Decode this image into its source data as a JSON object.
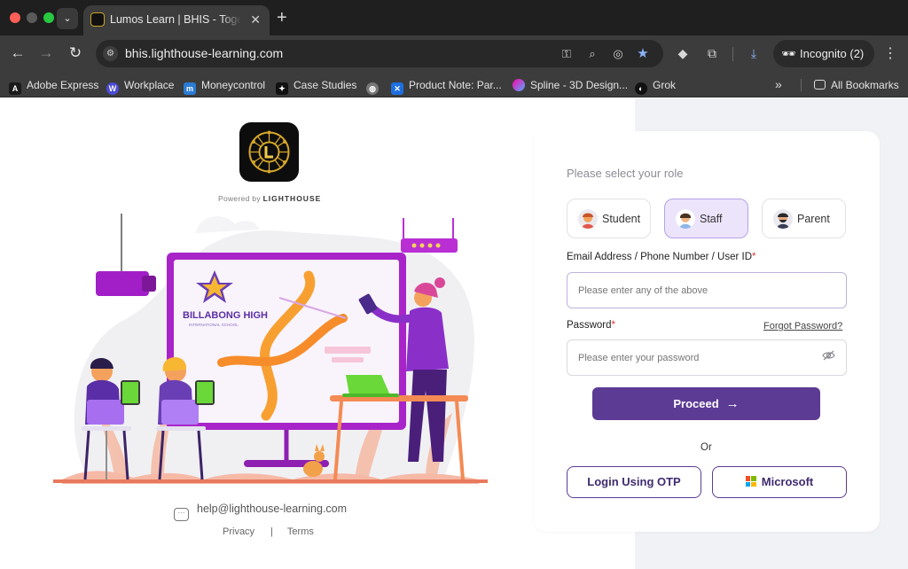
{
  "browser": {
    "tab_title": "Lumos Learn | BHIS - Together",
    "url": "bhis.lighthouse-learning.com",
    "incognito_label": "Incognito (2)",
    "bookmarks": [
      {
        "label": "Adobe Express",
        "color": "#1a1a1a"
      },
      {
        "label": "Workplace",
        "color": "#4b4bd6"
      },
      {
        "label": "Moneycontrol",
        "color": "#2a7bd4"
      },
      {
        "label": "Case Studies",
        "color": "#111111"
      },
      {
        "label": "",
        "color": "#777777"
      },
      {
        "label": "Product Note: Par...",
        "color": "#1d6fe0"
      },
      {
        "label": "Spline - 3D Design...",
        "color": "#b64fe0"
      },
      {
        "label": "Grok",
        "color": "#111111"
      }
    ],
    "all_bookmarks": "All Bookmarks"
  },
  "branding": {
    "powered_by": "Powered by",
    "brand": "LIGHTHOUSE",
    "school_name": "BILLABONG HIGH",
    "school_sub": "INTERNATIONAL SCHOOL"
  },
  "login": {
    "role_title": "Please select your role",
    "roles": [
      {
        "label": "Student",
        "selected": false
      },
      {
        "label": "Staff",
        "selected": true
      },
      {
        "label": "Parent",
        "selected": false
      }
    ],
    "email_label": "Email Address / Phone Number / User ID",
    "email_placeholder": "Please enter any of the above",
    "password_label": "Password",
    "password_placeholder": "Please enter your password",
    "forgot": "Forgot Password?",
    "proceed": "Proceed",
    "or": "Or",
    "otp_button": "Login Using OTP",
    "microsoft_button": "Microsoft"
  },
  "footer": {
    "help_email": "help@lighthouse-learning.com",
    "privacy": "Privacy",
    "terms": "Terms"
  },
  "colors": {
    "brand_purple": "#5c3b95",
    "selected_role_bg": "#ece4fb",
    "right_panel_bg": "#f1f2f5"
  }
}
